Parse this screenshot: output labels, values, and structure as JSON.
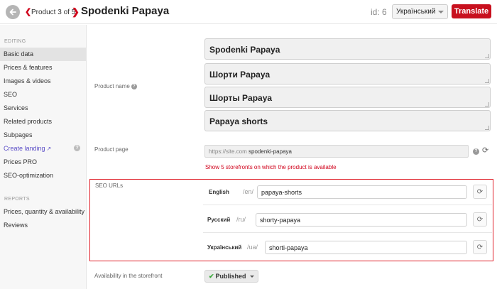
{
  "header": {
    "counter": "Product 3 of 5",
    "title": "Spodenki Papaya",
    "id_label": "id: 6",
    "language": "Український",
    "translate_label": "Translate"
  },
  "sidebar": {
    "editing_label": "EDITING",
    "editing_items": [
      {
        "label": "Basic data"
      },
      {
        "label": "Prices & features"
      },
      {
        "label": "Images & videos"
      },
      {
        "label": "SEO"
      },
      {
        "label": "Services"
      },
      {
        "label": "Related products"
      },
      {
        "label": "Subpages"
      },
      {
        "label": "Create landing"
      },
      {
        "label": "Prices PRO"
      },
      {
        "label": "SEO-optimization"
      }
    ],
    "reports_label": "REPORTS",
    "reports_items": [
      {
        "label": "Prices, quantity & availability"
      },
      {
        "label": "Reviews"
      }
    ]
  },
  "product_name": {
    "label": "Product name",
    "values": [
      "Spodenki Papaya",
      "Шорти Papaya",
      "Шорты Papaya",
      "Papaya shorts"
    ]
  },
  "product_page": {
    "label": "Product page",
    "prefix": "https://site.com",
    "slug": "spodenki-papaya",
    "storefronts_link": "Show 5 storefronts on which the product is available"
  },
  "seo_urls": {
    "label": "SEO URLs",
    "rows": [
      {
        "lang": "English",
        "path": "/en/",
        "value": "papaya-shorts"
      },
      {
        "lang": "Русский",
        "path": "/ru/",
        "value": "shorty-papaya"
      },
      {
        "lang": "Український",
        "path": "/ua/",
        "value": "shorti-papaya"
      }
    ]
  },
  "availability": {
    "label": "Availability in the storefront",
    "status": "Published"
  },
  "colors": {
    "accent_red": "#c8101e",
    "link_purple": "#5b4ec7",
    "published_green": "#3aa83a"
  },
  "icons": {
    "back": "back-arrow-icon",
    "refresh": "refresh-icon",
    "help": "help-icon",
    "external": "external-link-icon"
  }
}
